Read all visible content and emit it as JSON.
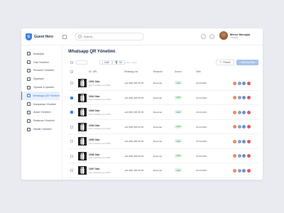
{
  "brand": {
    "name": "Guest Hero"
  },
  "search": {
    "placeholder": "Arama..."
  },
  "user": {
    "name": "Merve Meroğlu",
    "role": "Yönetici"
  },
  "sidebar": {
    "items": [
      {
        "label": "Anasayfa"
      },
      {
        "label": "Oda Yönetimi"
      },
      {
        "label": "Personel Yönetimi"
      },
      {
        "label": "Siparişler"
      },
      {
        "label": "Yiyecek & İçeceklr"
      },
      {
        "label": "Whatsapp QR Yönetimi",
        "active": true
      },
      {
        "label": "Kampanya Yönetimi"
      },
      {
        "label": "Anket Yönetimi"
      },
      {
        "label": "Restoran Yönetimi"
      },
      {
        "label": "Misafir Yönetimi"
      }
    ]
  },
  "page": {
    "title": "Whatsapp QR Yönetimi"
  },
  "toolbar": {
    "export_label": "İndir",
    "delete_label": "Sil",
    "hint": "1 satır seçildi",
    "filter_label": "Filtrele",
    "add_label": "+ QR Kod Ekle"
  },
  "table": {
    "headers": {
      "id": "ID / URL",
      "phone": "Whatsapp No",
      "restaurant": "Restoran",
      "status": "Durum",
      "date": "Tarih"
    },
    "rows": [
      {
        "id": "1001 Oda",
        "url": "http://misafirqr.com/1001",
        "phone": "+90 (555) 555 55 55",
        "restaurant": "Restoran",
        "status": "Aktif",
        "date": "15.03.2023",
        "checked": false
      },
      {
        "id": "1002 Oda",
        "url": "http://misafirqr.com/1002",
        "phone": "+90 (555) 555 55 55",
        "restaurant": "Restoran",
        "status": "Aktif",
        "date": "15.03.2023",
        "checked": true
      },
      {
        "id": "1003 Oda",
        "url": "http://misafirqr.com/1003",
        "phone": "+90 (555) 555 55 55",
        "restaurant": "Restoran",
        "status": "Aktif",
        "date": "15.03.2023",
        "checked": true
      },
      {
        "id": "1004 Oda",
        "url": "http://misafirqr.com/1004",
        "phone": "+90 (555) 555 55 55",
        "restaurant": "Restoran",
        "status": "Aktif",
        "date": "15.03.2023",
        "checked": false
      },
      {
        "id": "1005 Oda",
        "url": "http://misafirqr.com/1005",
        "phone": "+90 (555) 555 55 55",
        "restaurant": "Restoran",
        "status": "Aktif",
        "date": "15.03.2023",
        "checked": false
      },
      {
        "id": "1006 Oda",
        "url": "http://misafirqr.com/1006",
        "phone": "+90 (555) 555 55 55",
        "restaurant": "Restoran",
        "status": "Aktif",
        "date": "15.03.2023",
        "checked": false
      },
      {
        "id": "1007 Oda",
        "url": "http://misafirqr.com/1007",
        "phone": "+90 (555) 555 55 55",
        "restaurant": "Restoran",
        "status": "Aktif",
        "date": "15.03.2023",
        "checked": false
      }
    ]
  },
  "colors": {
    "accent": "#3d7be0",
    "action_colors": [
      "#f08a5d",
      "#8fa1b8",
      "#6c8fd8",
      "#e45757"
    ]
  }
}
